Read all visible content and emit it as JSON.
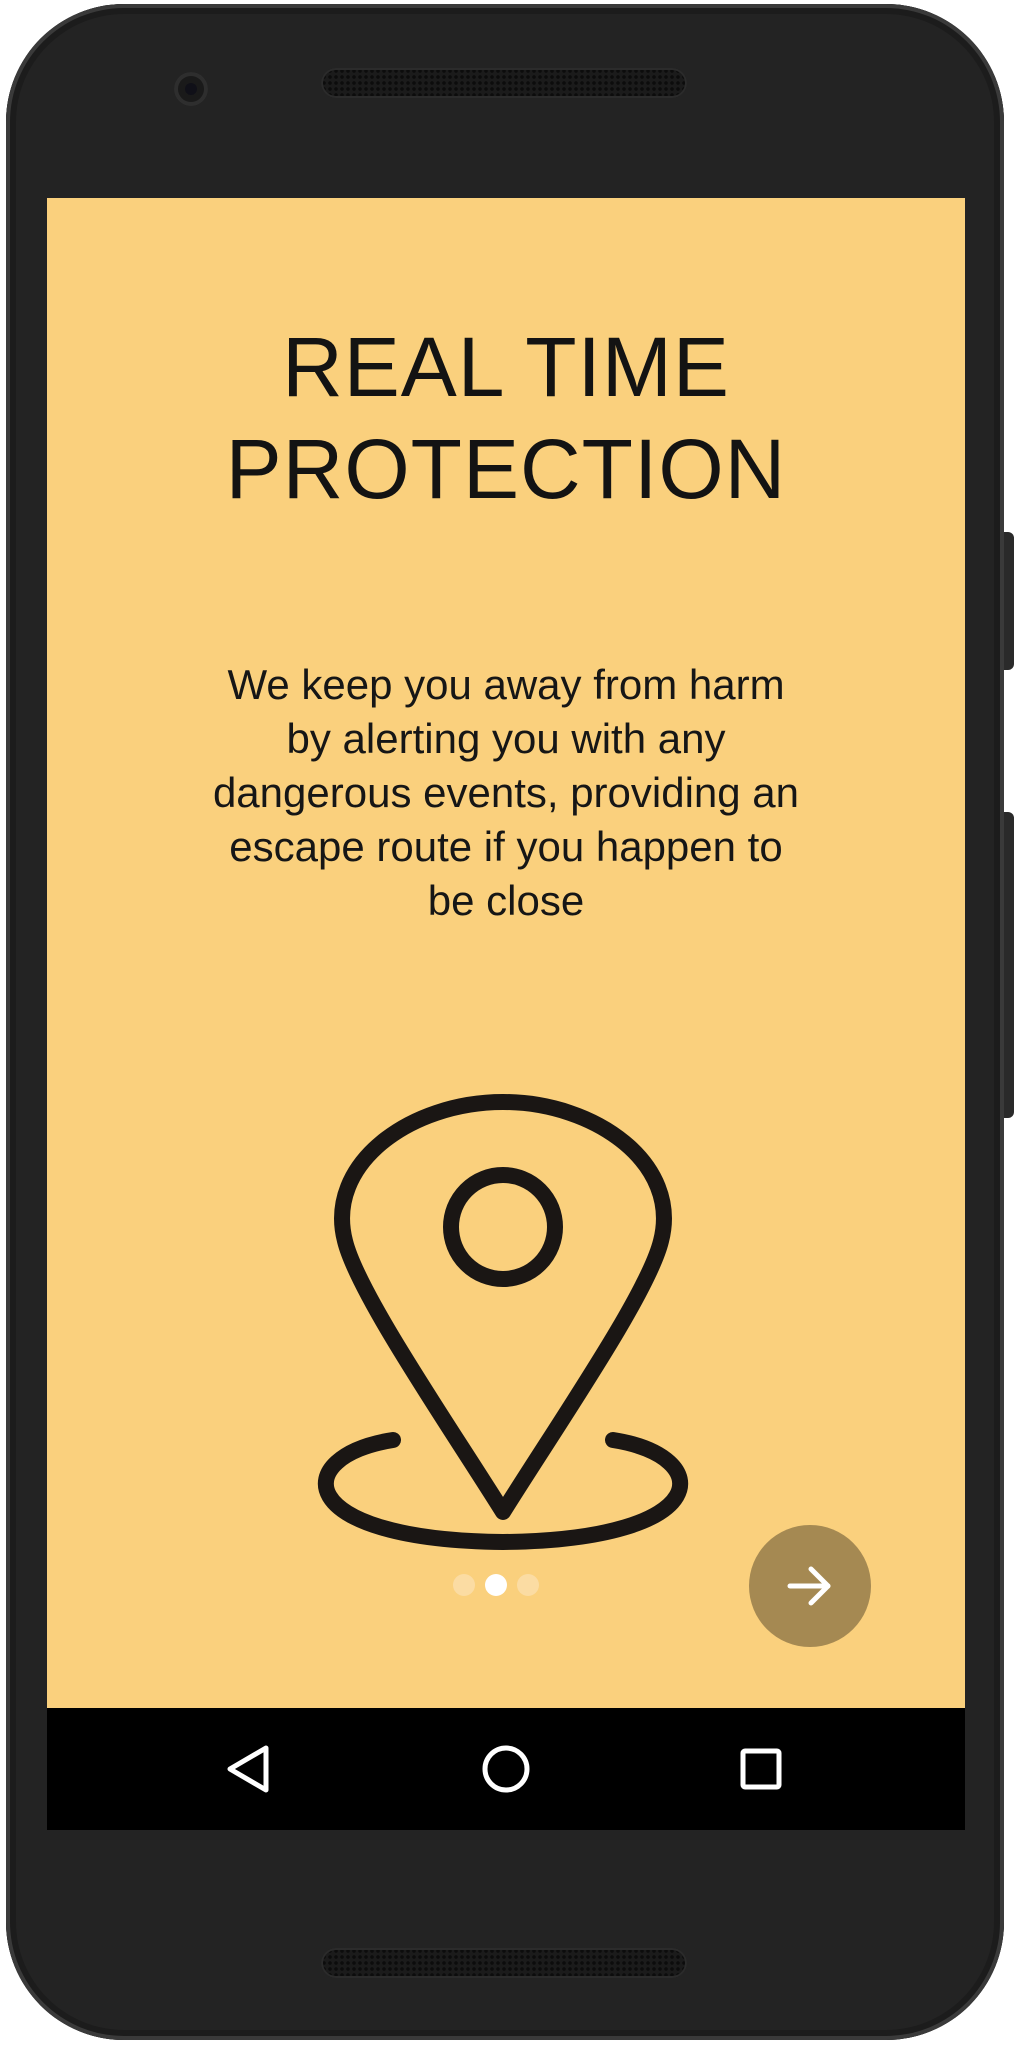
{
  "onboarding": {
    "title_line1": "REAL TIME",
    "title_line2": "PROTECTION",
    "description": "We keep you away from harm by alerting you with any dangerous events, providing an escape route if you happen to be close",
    "illustration_icon": "location-pin-icon",
    "page_indicator": {
      "total": 3,
      "current": 2
    },
    "next_button_icon": "arrow-right-icon"
  },
  "navbar": {
    "back_icon": "back-triangle-icon",
    "home_icon": "home-circle-icon",
    "recents_icon": "recents-square-icon"
  },
  "colors": {
    "background": "#fad07d",
    "text": "#131313",
    "next_button": "#a58952",
    "dot_active": "#ffffff",
    "dot_inactive": "#fbdca3",
    "navbar": "#000000"
  }
}
